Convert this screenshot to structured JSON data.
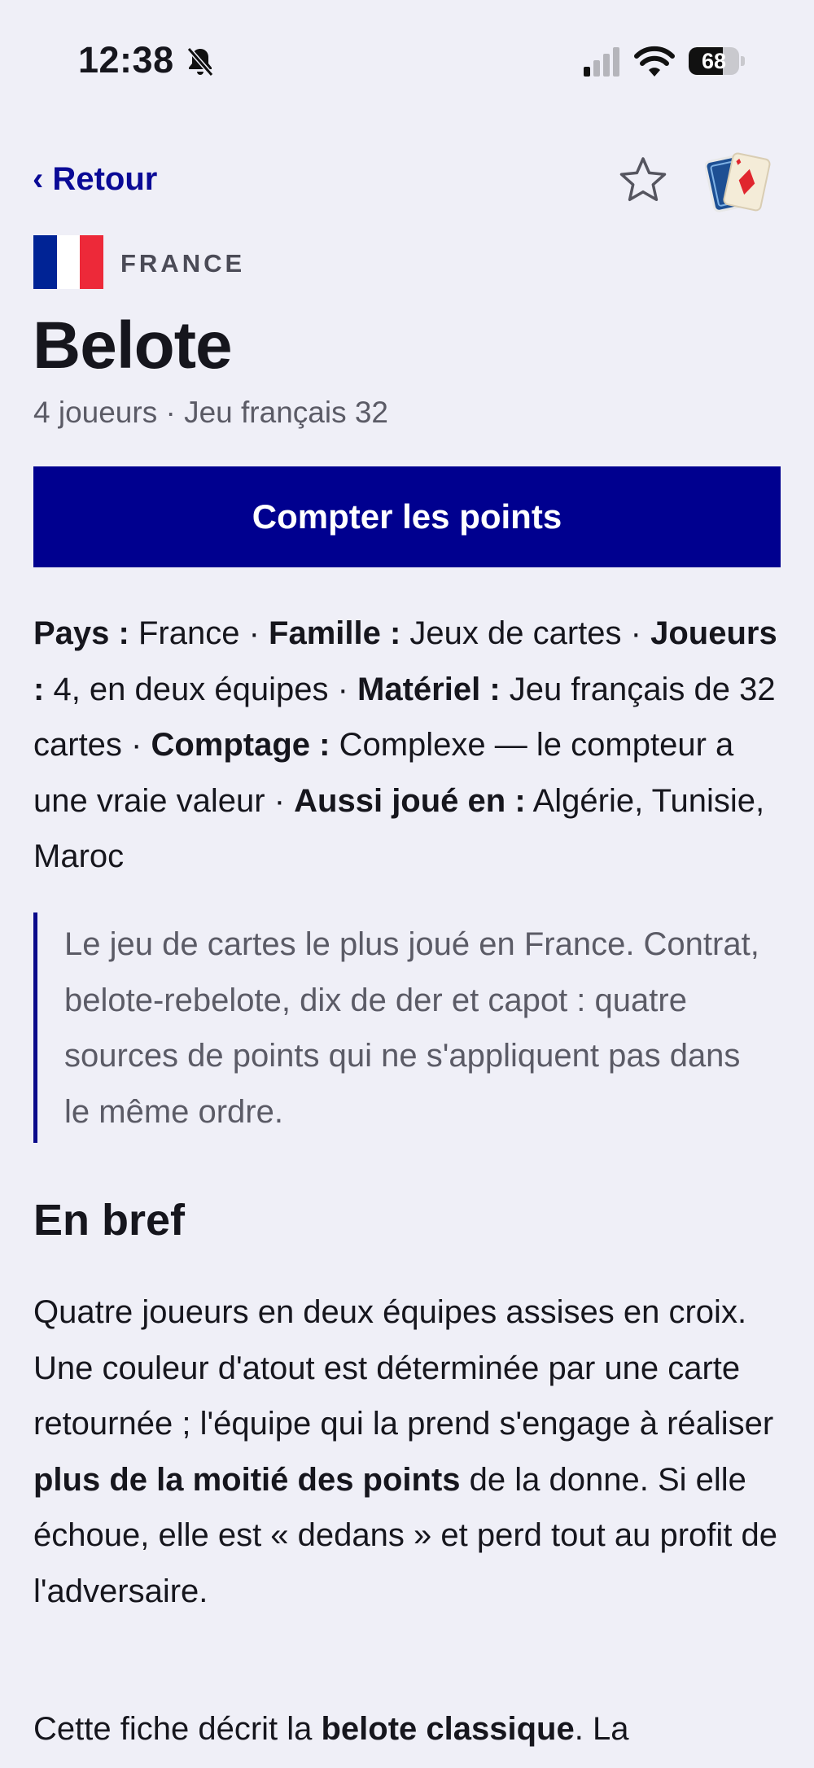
{
  "status": {
    "time": "12:38",
    "battery": "68",
    "battery_level": 0.68,
    "icons": [
      "bell-slash-icon",
      "cellular-signal-icon",
      "wifi-icon",
      "battery-icon"
    ]
  },
  "nav": {
    "back_label": "‹ Retour",
    "icons": [
      "star-icon",
      "playing-cards-icon"
    ]
  },
  "header": {
    "flag": "france-flag",
    "flag_colors": [
      "#002395",
      "#ffffff",
      "#ed2939"
    ],
    "country": "FRANCE",
    "title": "Belote",
    "subtitle": "4 joueurs · Jeu français 32"
  },
  "cta": {
    "label": "Compter les points",
    "color": "#00008f"
  },
  "meta": {
    "pays_label": "Pays :",
    "pays_value": " France · ",
    "famille_label": "Famille :",
    "famille_value": " Jeux de cartes · ",
    "joueurs_label": "Joueurs :",
    "joueurs_value": " 4, en deux équipes · ",
    "materiel_label": "Matériel :",
    "materiel_value": " Jeu français de 32 cartes · ",
    "comptage_label": "Comptage :",
    "comptage_value": " Complexe — le compteur a une vraie valeur · ",
    "aussi_label": "Aussi joué en :",
    "aussi_value": " Algérie, Tunisie, Maroc"
  },
  "quote": "Le jeu de cartes le plus joué en France. Contrat, belote-rebelote, dix de der et capot : quatre sources de points qui ne s'appliquent pas dans le même ordre.",
  "bref": {
    "heading": "En bref",
    "p1_a": "Quatre joueurs en deux équipes assises en croix. Une couleur d'atout est déterminée par une carte retournée ; l'équipe qui la prend s'engage à réaliser ",
    "p1_b": "plus de la moitié des points",
    "p1_c": " de la donne. Si elle échoue, elle est « dedans » et perd tout au profit de l'adversaire.",
    "p2_a": "Cette fiche décrit la ",
    "p2_b": "belote classique",
    "p2_c": ". La"
  }
}
